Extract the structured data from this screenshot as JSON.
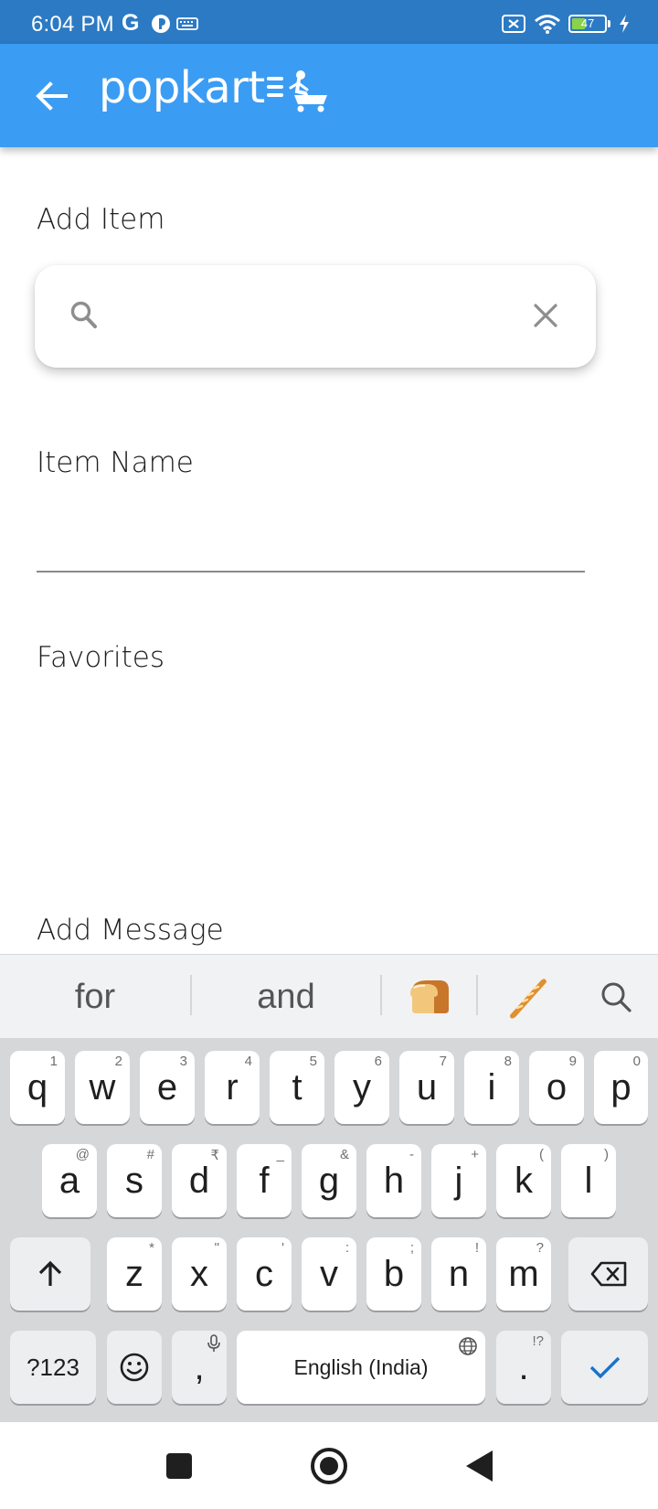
{
  "status_bar": {
    "time": "6:04 PM",
    "carrier_glyph": "G",
    "battery_level": "47",
    "battery_fraction": 0.47,
    "icons": [
      "pocket-casts-icon",
      "keyboard-icon",
      "no-sim-icon",
      "wifi-icon",
      "battery-icon",
      "charging-icon"
    ]
  },
  "app_bar": {
    "logo": "popkart",
    "back_icon": "arrow-left-icon"
  },
  "form": {
    "add_item_label": "Add Item",
    "search_value": "",
    "item_name_label": "Item Name",
    "item_name_value": "",
    "favorites_label": "Favorites",
    "add_message_label": "Add Message"
  },
  "keyboard": {
    "suggestions": [
      "for",
      "and"
    ],
    "suggestion_emojis": [
      "bread-emoji",
      "baguette-emoji"
    ],
    "row1": [
      {
        "k": "q",
        "h": "1"
      },
      {
        "k": "w",
        "h": "2"
      },
      {
        "k": "e",
        "h": "3"
      },
      {
        "k": "r",
        "h": "4"
      },
      {
        "k": "t",
        "h": "5"
      },
      {
        "k": "y",
        "h": "6"
      },
      {
        "k": "u",
        "h": "7"
      },
      {
        "k": "i",
        "h": "8"
      },
      {
        "k": "o",
        "h": "9"
      },
      {
        "k": "p",
        "h": "0"
      }
    ],
    "row2": [
      {
        "k": "a",
        "h": "@"
      },
      {
        "k": "s",
        "h": "#"
      },
      {
        "k": "d",
        "h": "₹"
      },
      {
        "k": "f",
        "h": "_"
      },
      {
        "k": "g",
        "h": "&"
      },
      {
        "k": "h",
        "h": "-"
      },
      {
        "k": "j",
        "h": "+"
      },
      {
        "k": "k",
        "h": "("
      },
      {
        "k": "l",
        "h": ")"
      }
    ],
    "row3": [
      {
        "k": "z",
        "h": "*"
      },
      {
        "k": "x",
        "h": "\""
      },
      {
        "k": "c",
        "h": "'"
      },
      {
        "k": "v",
        "h": ":"
      },
      {
        "k": "b",
        "h": ";"
      },
      {
        "k": "n",
        "h": "!"
      },
      {
        "k": "m",
        "h": "?"
      }
    ],
    "symbols_key": "?123",
    "comma_key": ",",
    "space_key": "English (India)",
    "period_key": ".",
    "period_hint": "!?"
  },
  "colors": {
    "status_bar": "#2c7ac4",
    "app_bar": "#3b9cf3",
    "keyboard_accent": "#1a73c9"
  }
}
